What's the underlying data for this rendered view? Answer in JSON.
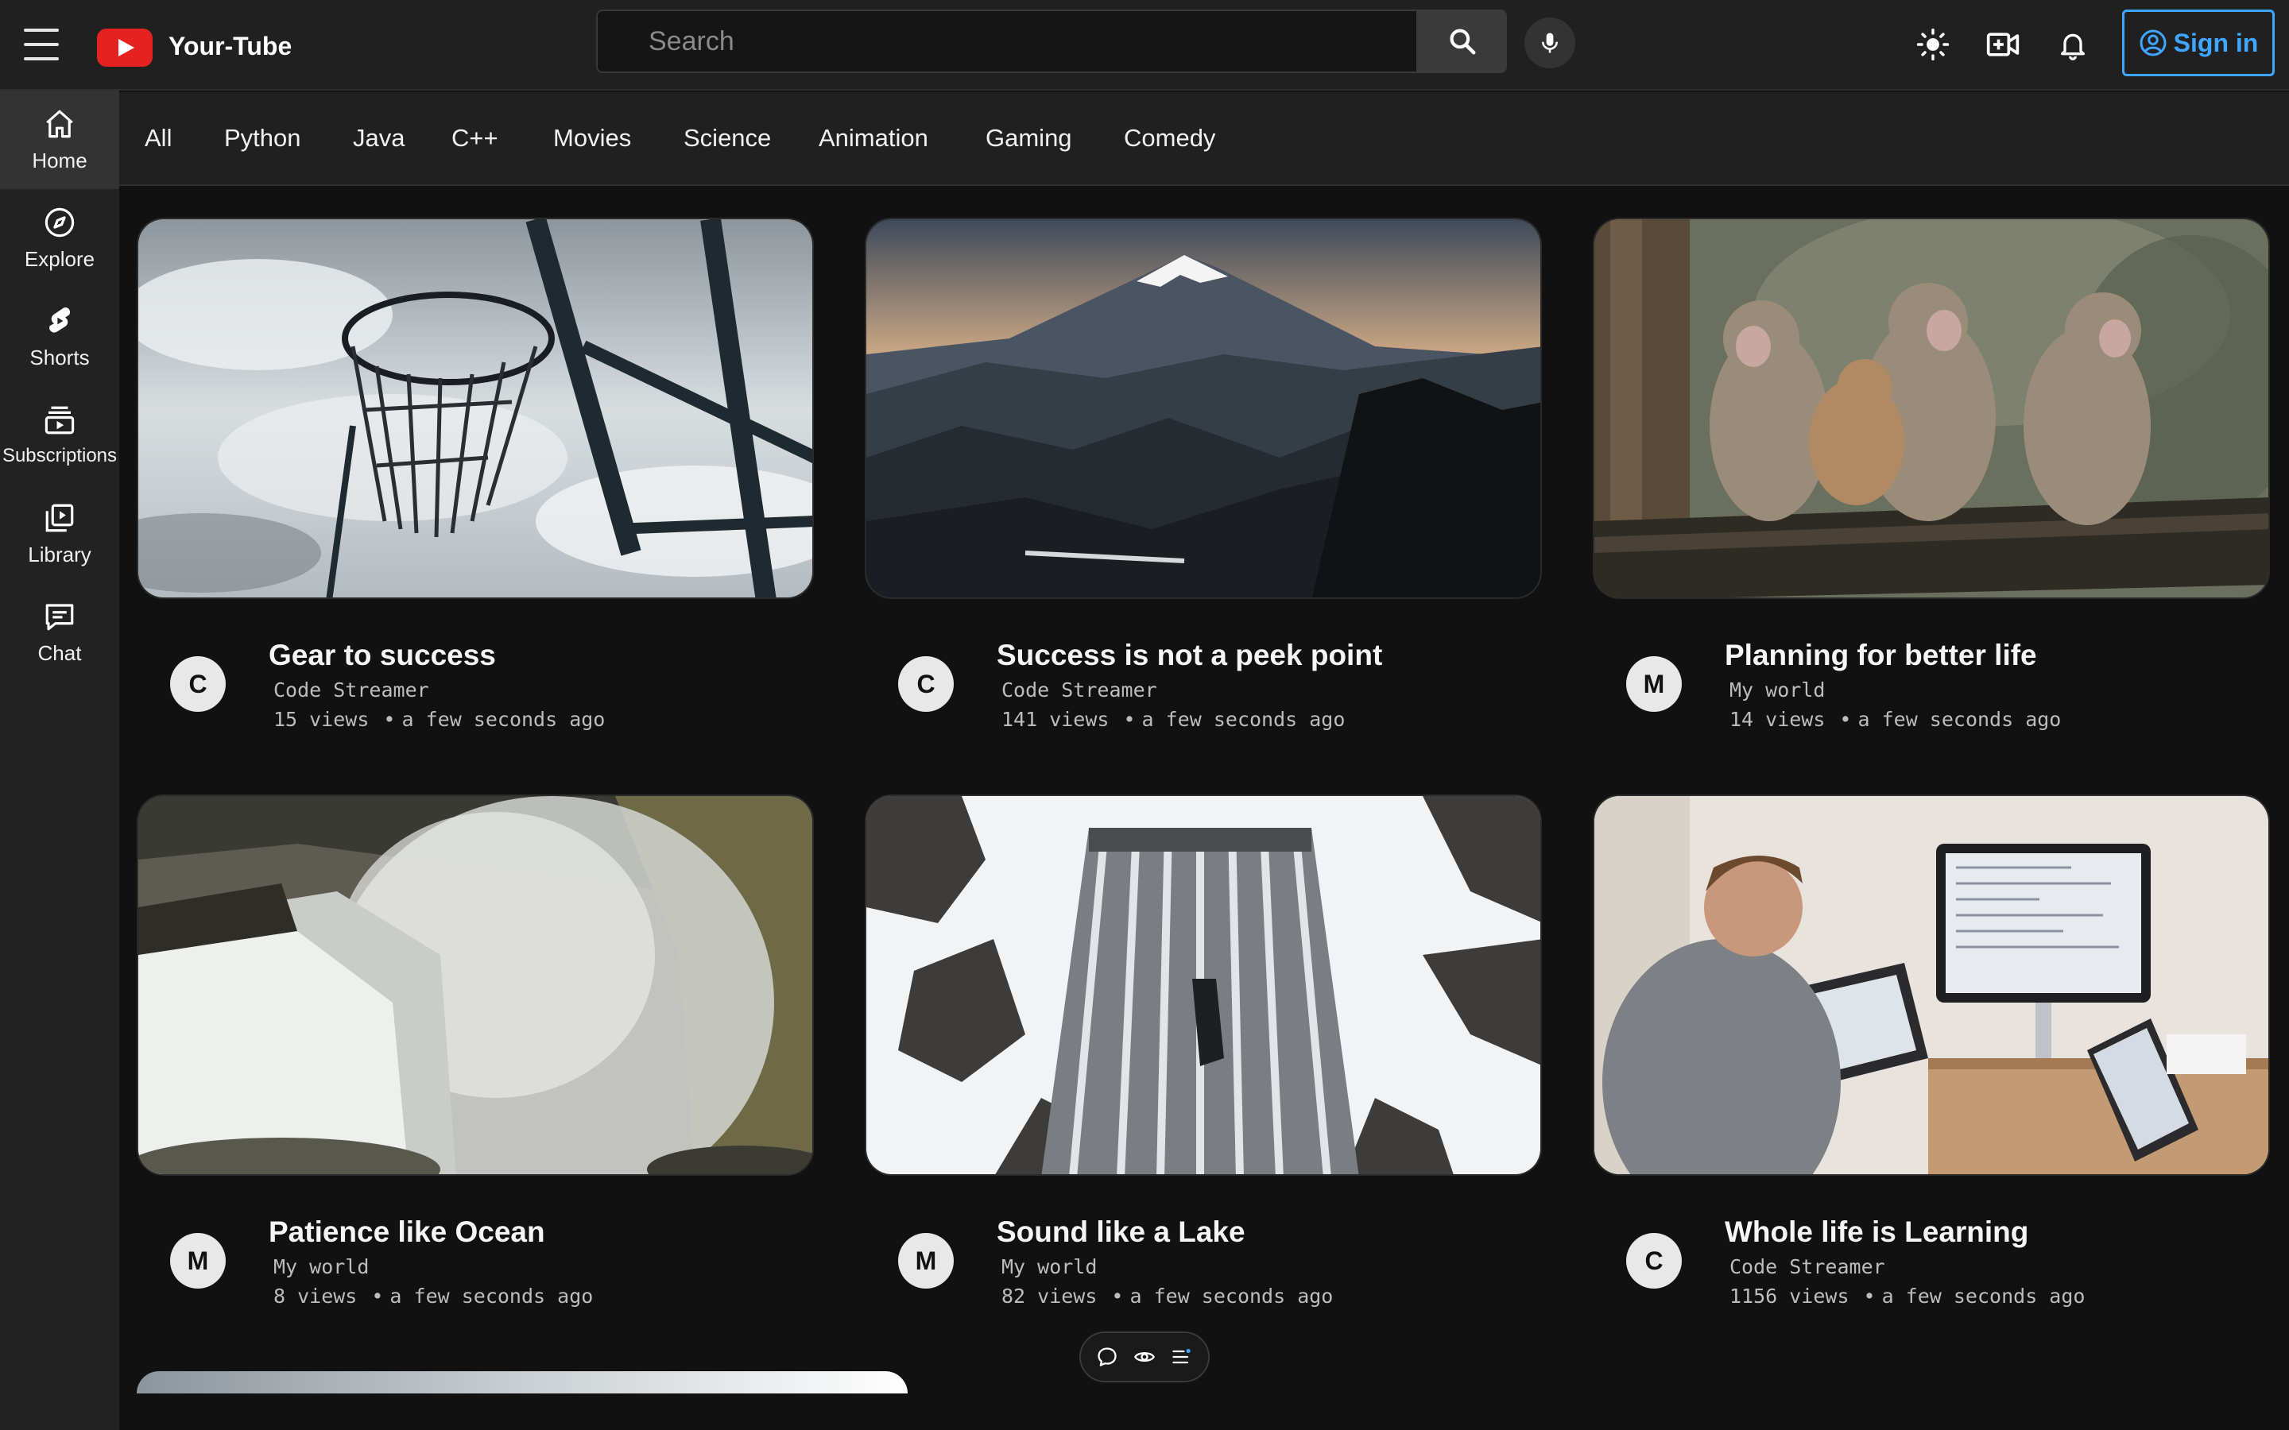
{
  "header": {
    "app_name": "Your-Tube",
    "search_placeholder": "Search",
    "signin_label": "Sign in"
  },
  "sidebar": {
    "items": [
      {
        "label": "Home",
        "icon": "home-icon"
      },
      {
        "label": "Explore",
        "icon": "compass-icon"
      },
      {
        "label": "Shorts",
        "icon": "shorts-icon"
      },
      {
        "label": "Subscriptions",
        "icon": "subscriptions-icon"
      },
      {
        "label": "Library",
        "icon": "library-icon"
      },
      {
        "label": "Chat",
        "icon": "chat-icon"
      }
    ]
  },
  "categories": [
    "All",
    "Python",
    "Java",
    "C++",
    "Movies",
    "Science",
    "Animation",
    "Gaming",
    "Comedy"
  ],
  "videos": [
    {
      "title": "Gear to success",
      "channel": "Code Streamer",
      "avatar": "C",
      "views": "15 views",
      "time": "a few seconds ago"
    },
    {
      "title": "Success is not a peek point",
      "channel": "Code Streamer",
      "avatar": "C",
      "views": "141 views",
      "time": "a few seconds ago"
    },
    {
      "title": "Planning for better life",
      "channel": "My world",
      "avatar": "M",
      "views": "14 views",
      "time": "a few seconds ago"
    },
    {
      "title": "Patience like Ocean",
      "channel": "My world",
      "avatar": "M",
      "views": "8 views",
      "time": "a few seconds ago"
    },
    {
      "title": "Sound like a Lake",
      "channel": "My world",
      "avatar": "M",
      "views": "82 views",
      "time": "a few seconds ago"
    },
    {
      "title": "Whole life is Learning",
      "channel": "Code Streamer",
      "avatar": "C",
      "views": "1156 views",
      "time": "a few seconds ago"
    }
  ],
  "colors": {
    "background": "#111111",
    "topbar": "#202020",
    "sidebar": "#222222",
    "accent_blue": "#3ea6ff",
    "logo_red": "#e52222"
  }
}
